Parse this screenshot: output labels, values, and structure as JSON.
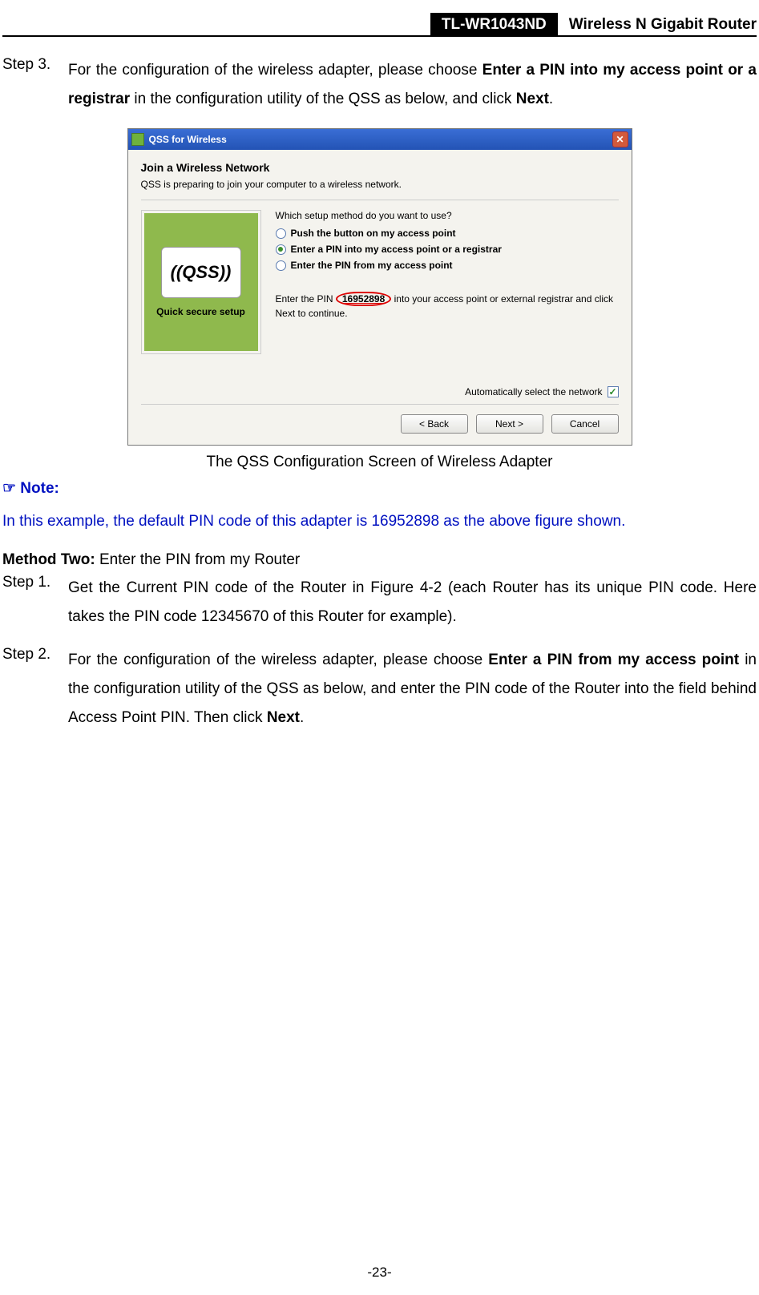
{
  "header": {
    "model": "TL-WR1043ND",
    "product": "Wireless N Gigabit Router"
  },
  "step3": {
    "label": "Step 3.",
    "t1": "For the configuration of the wireless adapter, please choose ",
    "b1": "Enter a PIN into my access point or a registrar",
    "t2": " in the configuration utility of the QSS as below, and click ",
    "b2": "Next",
    "t3": "."
  },
  "xp": {
    "title": "QSS for Wireless",
    "panel_title": "Join a Wireless Network",
    "panel_sub": "QSS is preparing to join your computer to a wireless network.",
    "qss_logo": "QSS",
    "qss_sub": "Quick secure setup",
    "question": "Which setup method do you want to use?",
    "opt1": "Push the button on my access point",
    "opt2": "Enter a PIN into my access point or a registrar",
    "opt3": "Enter the PIN from my access point",
    "pin_pre": "Enter the PIN ",
    "pin_val": "16952898",
    "pin_post": " into your access point or external registrar and click Next to continue.",
    "auto": "Automatically select the network",
    "back": "< Back",
    "next": "Next >",
    "cancel": "Cancel"
  },
  "caption": "The QSS Configuration Screen of Wireless Adapter",
  "note": {
    "head": "☞ Note:",
    "body": "In this example, the default PIN code of this adapter is 16952898 as the above figure shown."
  },
  "method2": {
    "label_bold": "Method Two:",
    "label_rest": " Enter the PIN from my Router"
  },
  "m2s1": {
    "label": "Step 1.",
    "text": "Get the Current PIN code of the Router in Figure 4-2 (each Router has its unique PIN code. Here takes the PIN code 12345670 of this Router for example)."
  },
  "m2s2": {
    "label": "Step 2.",
    "t1": "For the configuration of the wireless adapter, please choose ",
    "b1": "Enter a PIN from my access point",
    "t2": " in the configuration utility of the QSS as below, and enter the PIN code of the Router into the field behind Access Point PIN. Then click ",
    "b2": "Next",
    "t3": "."
  },
  "page_number": "-23-"
}
